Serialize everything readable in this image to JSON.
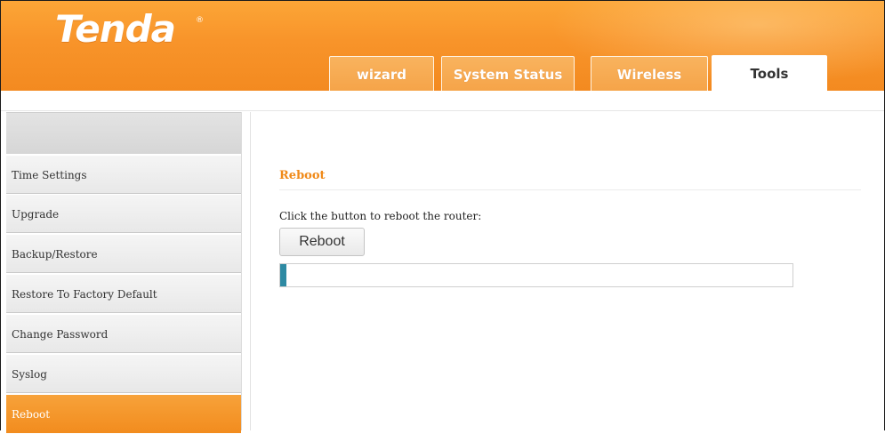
{
  "brand": {
    "logo": "Tenda",
    "mark": "®"
  },
  "tabs": [
    {
      "label": "wizard",
      "active": false
    },
    {
      "label": "System Status",
      "active": false
    },
    {
      "label": "Wireless",
      "active": false
    },
    {
      "label": "Tools",
      "active": true
    }
  ],
  "sidebar": {
    "items": [
      {
        "label": "Time Settings",
        "active": false
      },
      {
        "label": "Upgrade",
        "active": false
      },
      {
        "label": "Backup/Restore",
        "active": false
      },
      {
        "label": "Restore To Factory Default",
        "active": false
      },
      {
        "label": "Change Password",
        "active": false
      },
      {
        "label": "Syslog",
        "active": false
      },
      {
        "label": "Reboot",
        "active": true
      }
    ]
  },
  "main": {
    "section_title": "Reboot",
    "hint": "Click the button to reboot the router:",
    "reboot_button": "Reboot",
    "progress_fraction": 0.012
  },
  "colors": {
    "accent_orange": "#f28c1e",
    "section_title": "#f08a19",
    "progress_fill": "#2e8aa3"
  }
}
